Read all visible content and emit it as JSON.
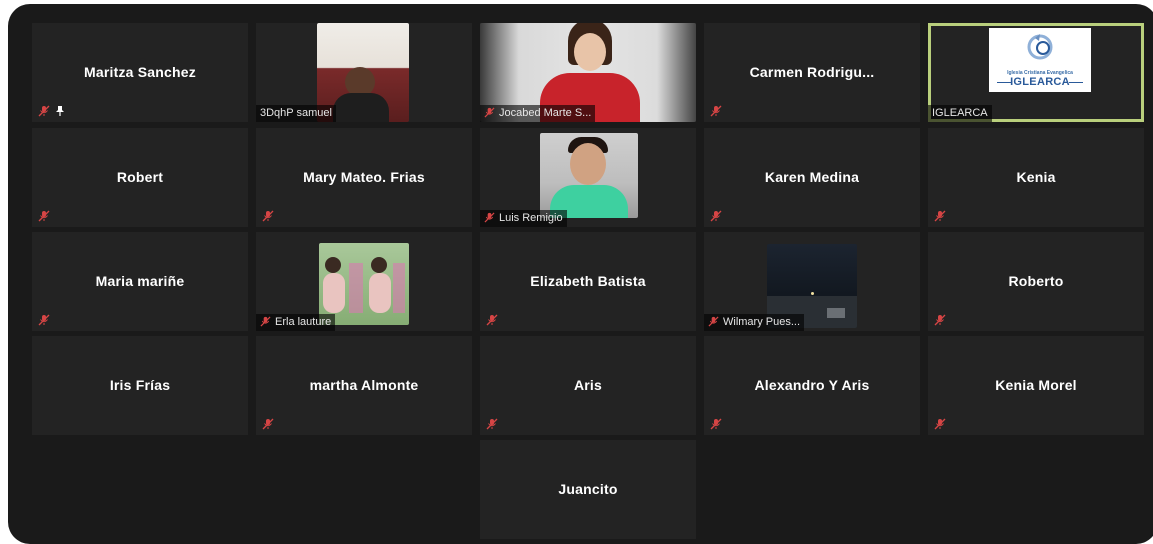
{
  "participants": [
    {
      "name": "Maritza Sanchez",
      "muted": true,
      "pinned": true
    },
    {
      "name": "3DqhP samuel",
      "video": true
    },
    {
      "name": "Jocabed Marte S...",
      "video": true,
      "muted": true
    },
    {
      "name": "Carmen  Rodrigu...",
      "muted": true
    },
    {
      "name": "IGLEARCA",
      "video": true,
      "active_speaker": true,
      "logo_text": "IGLEARCA",
      "logo_subtext": "Iglesia Cristiana Evangelica"
    },
    {
      "name": "Robert",
      "muted": true
    },
    {
      "name": "Mary Mateo. Frias",
      "muted": true
    },
    {
      "name": "Luis Remigio",
      "video": true,
      "muted": true
    },
    {
      "name": "Karen Medina",
      "muted": true
    },
    {
      "name": "Kenia",
      "muted": true
    },
    {
      "name": "Maria mariñe",
      "muted": true
    },
    {
      "name": "Erla lauture",
      "video": true,
      "muted": true
    },
    {
      "name": "Elizabeth Batista",
      "muted": true
    },
    {
      "name": "Wilmary Pues...",
      "video": true,
      "muted": true
    },
    {
      "name": "Roberto",
      "muted": true
    },
    {
      "name": "Iris Frías"
    },
    {
      "name": "martha Almonte",
      "muted": true
    },
    {
      "name": "Aris",
      "muted": true
    },
    {
      "name": "Alexandro Y Aris",
      "muted": true
    },
    {
      "name": "Kenia Morel",
      "muted": true
    },
    {
      "name": "Juancito"
    }
  ],
  "icons": {
    "muted": "mic-muted-icon",
    "pinned": "pin-icon"
  },
  "colors": {
    "tile_bg": "#232323",
    "frame_bg": "#1a1a1a",
    "muted_red": "#d64545",
    "active_border": "#b9cf7c"
  }
}
